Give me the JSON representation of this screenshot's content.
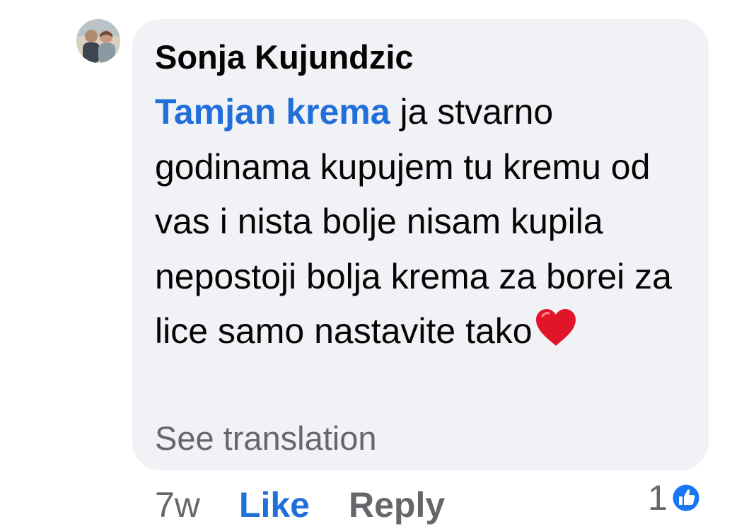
{
  "comment": {
    "author": "Sonja Kujundzic",
    "mention": "Tamjan krema",
    "text": " ja stvarno godinama kupujem tu kremu od vas i nista bolje nisam kupila nepostoji bolja krema za borei za lice samo nastavite tako",
    "emoji": "heart-emoji",
    "see_translation": "See translation"
  },
  "actions": {
    "time": "7w",
    "like_label": "Like",
    "reply_label": "Reply"
  },
  "reactions": {
    "count": "1",
    "icon": "like-reaction-icon"
  },
  "colors": {
    "bubble": "#f0f2f5",
    "link_blue": "#216fdb",
    "secondary_text": "#65676b",
    "primary_text": "#050505",
    "heart_red": "#e0152a"
  }
}
